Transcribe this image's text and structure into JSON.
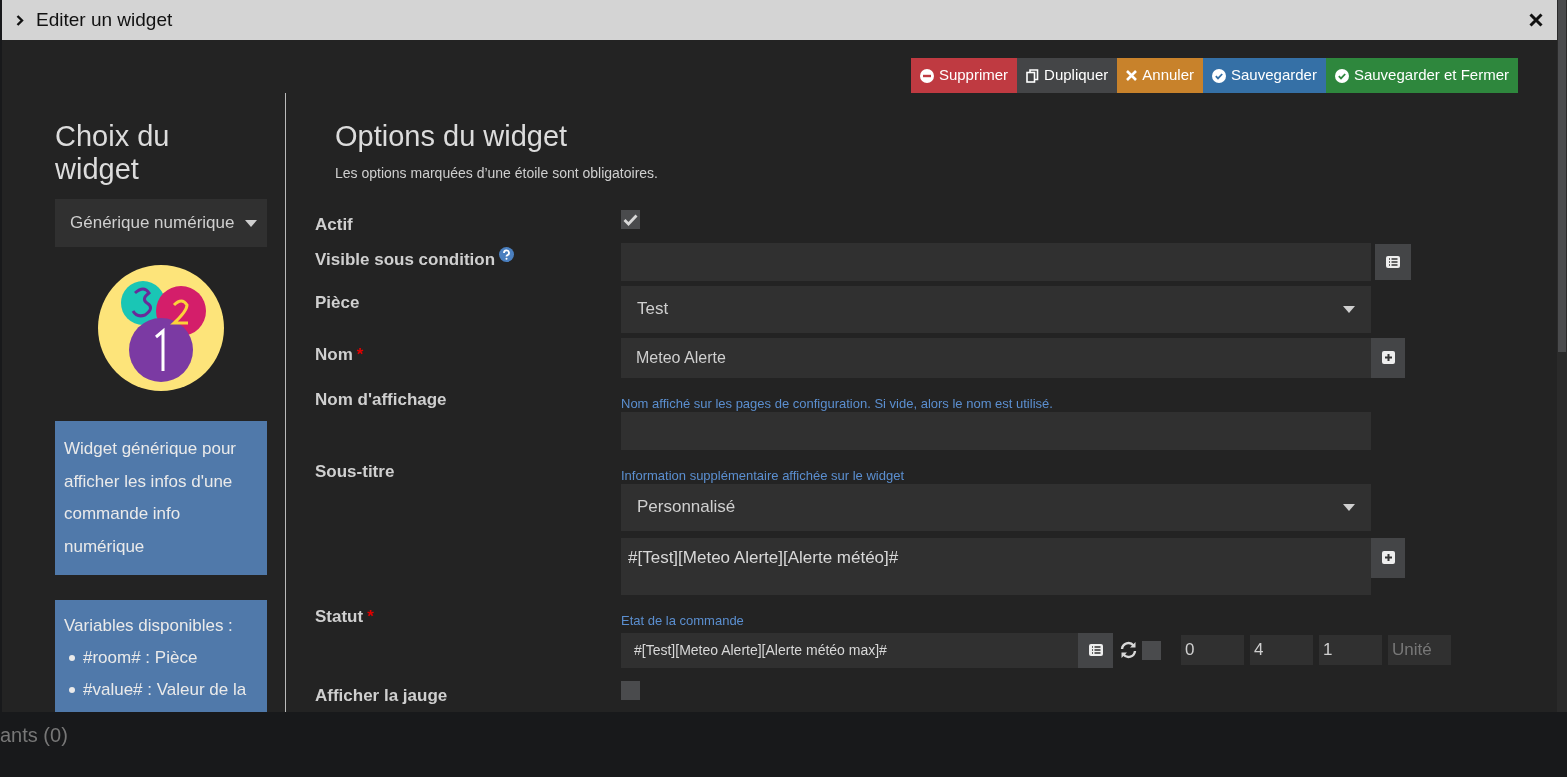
{
  "window": {
    "title": "Editer un widget"
  },
  "buttons": [
    {
      "label": "Supprimer",
      "kind": "danger"
    },
    {
      "label": "Dupliquer",
      "kind": "default"
    },
    {
      "label": "Annuler",
      "kind": "warning"
    },
    {
      "label": "Sauvegarder",
      "kind": "primary"
    },
    {
      "label": "Sauvegarder et Fermer",
      "kind": "success"
    }
  ],
  "sidebar": {
    "title": "Choix du widget",
    "widget_select": "Générique numérique",
    "description": "Widget générique pour afficher les infos d'une commande info numérique",
    "variables": {
      "title": "Variables disponibles :",
      "items": [
        "#room# : Pièce",
        "#value# : Valeur de la"
      ]
    }
  },
  "form": {
    "title": "Options du widget",
    "subtitle": "Les options marquées d’une étoile sont obligatoires.",
    "rows": [
      {
        "label": "Actif",
        "help": false,
        "controls": [
          {
            "kind": "checkbox",
            "checked": true
          }
        ]
      },
      {
        "label": "Visible sous condition",
        "help": true,
        "controls": [
          {
            "kind": "input",
            "button": {
              "kind": "list"
            }
          }
        ]
      },
      {
        "label": "Pièce",
        "help": false,
        "controls": [
          {
            "kind": "select",
            "value": "Test"
          }
        ]
      },
      {
        "label": "Nom",
        "required_mark": "*",
        "help": false,
        "controls": [
          {
            "kind": "input",
            "value": "Meteo Alerte",
            "button": {
              "kind": "plus"
            }
          }
        ]
      },
      {
        "label": "Nom d'affichage",
        "help": false,
        "controls": [
          {
            "kind": "hint",
            "text": "Nom affiché sur les pages de configuration. Si vide, alors le nom est utilisé."
          },
          {
            "kind": "input"
          }
        ]
      },
      {
        "label": "Sous-titre",
        "help": false,
        "controls": [
          {
            "kind": "hint",
            "text": "Information supplémentaire affichée sur le widget"
          },
          {
            "kind": "select",
            "value": "Personnalisé"
          },
          {
            "kind": "textarea",
            "value": "#[Test][Meteo Alerte][Alerte météo]#",
            "button": {
              "kind": "plus"
            }
          }
        ]
      },
      {
        "label": "Statut",
        "required_mark": "*",
        "help": false,
        "controls": [
          {
            "kind": "hint",
            "text": "Etat de la commande"
          },
          {
            "kind": "command",
            "value": "#[Test][Meteo Alerte][Alerte météo max]#",
            "checked": false,
            "min": "0",
            "max": "4",
            "step": "1",
            "unit_placeholder": "Unité"
          }
        ]
      },
      {
        "label": "Afficher la jauge",
        "help": false,
        "controls": [
          {
            "kind": "checkbox",
            "checked": false
          }
        ]
      }
    ]
  },
  "footer": {
    "text": "ants (0)"
  }
}
